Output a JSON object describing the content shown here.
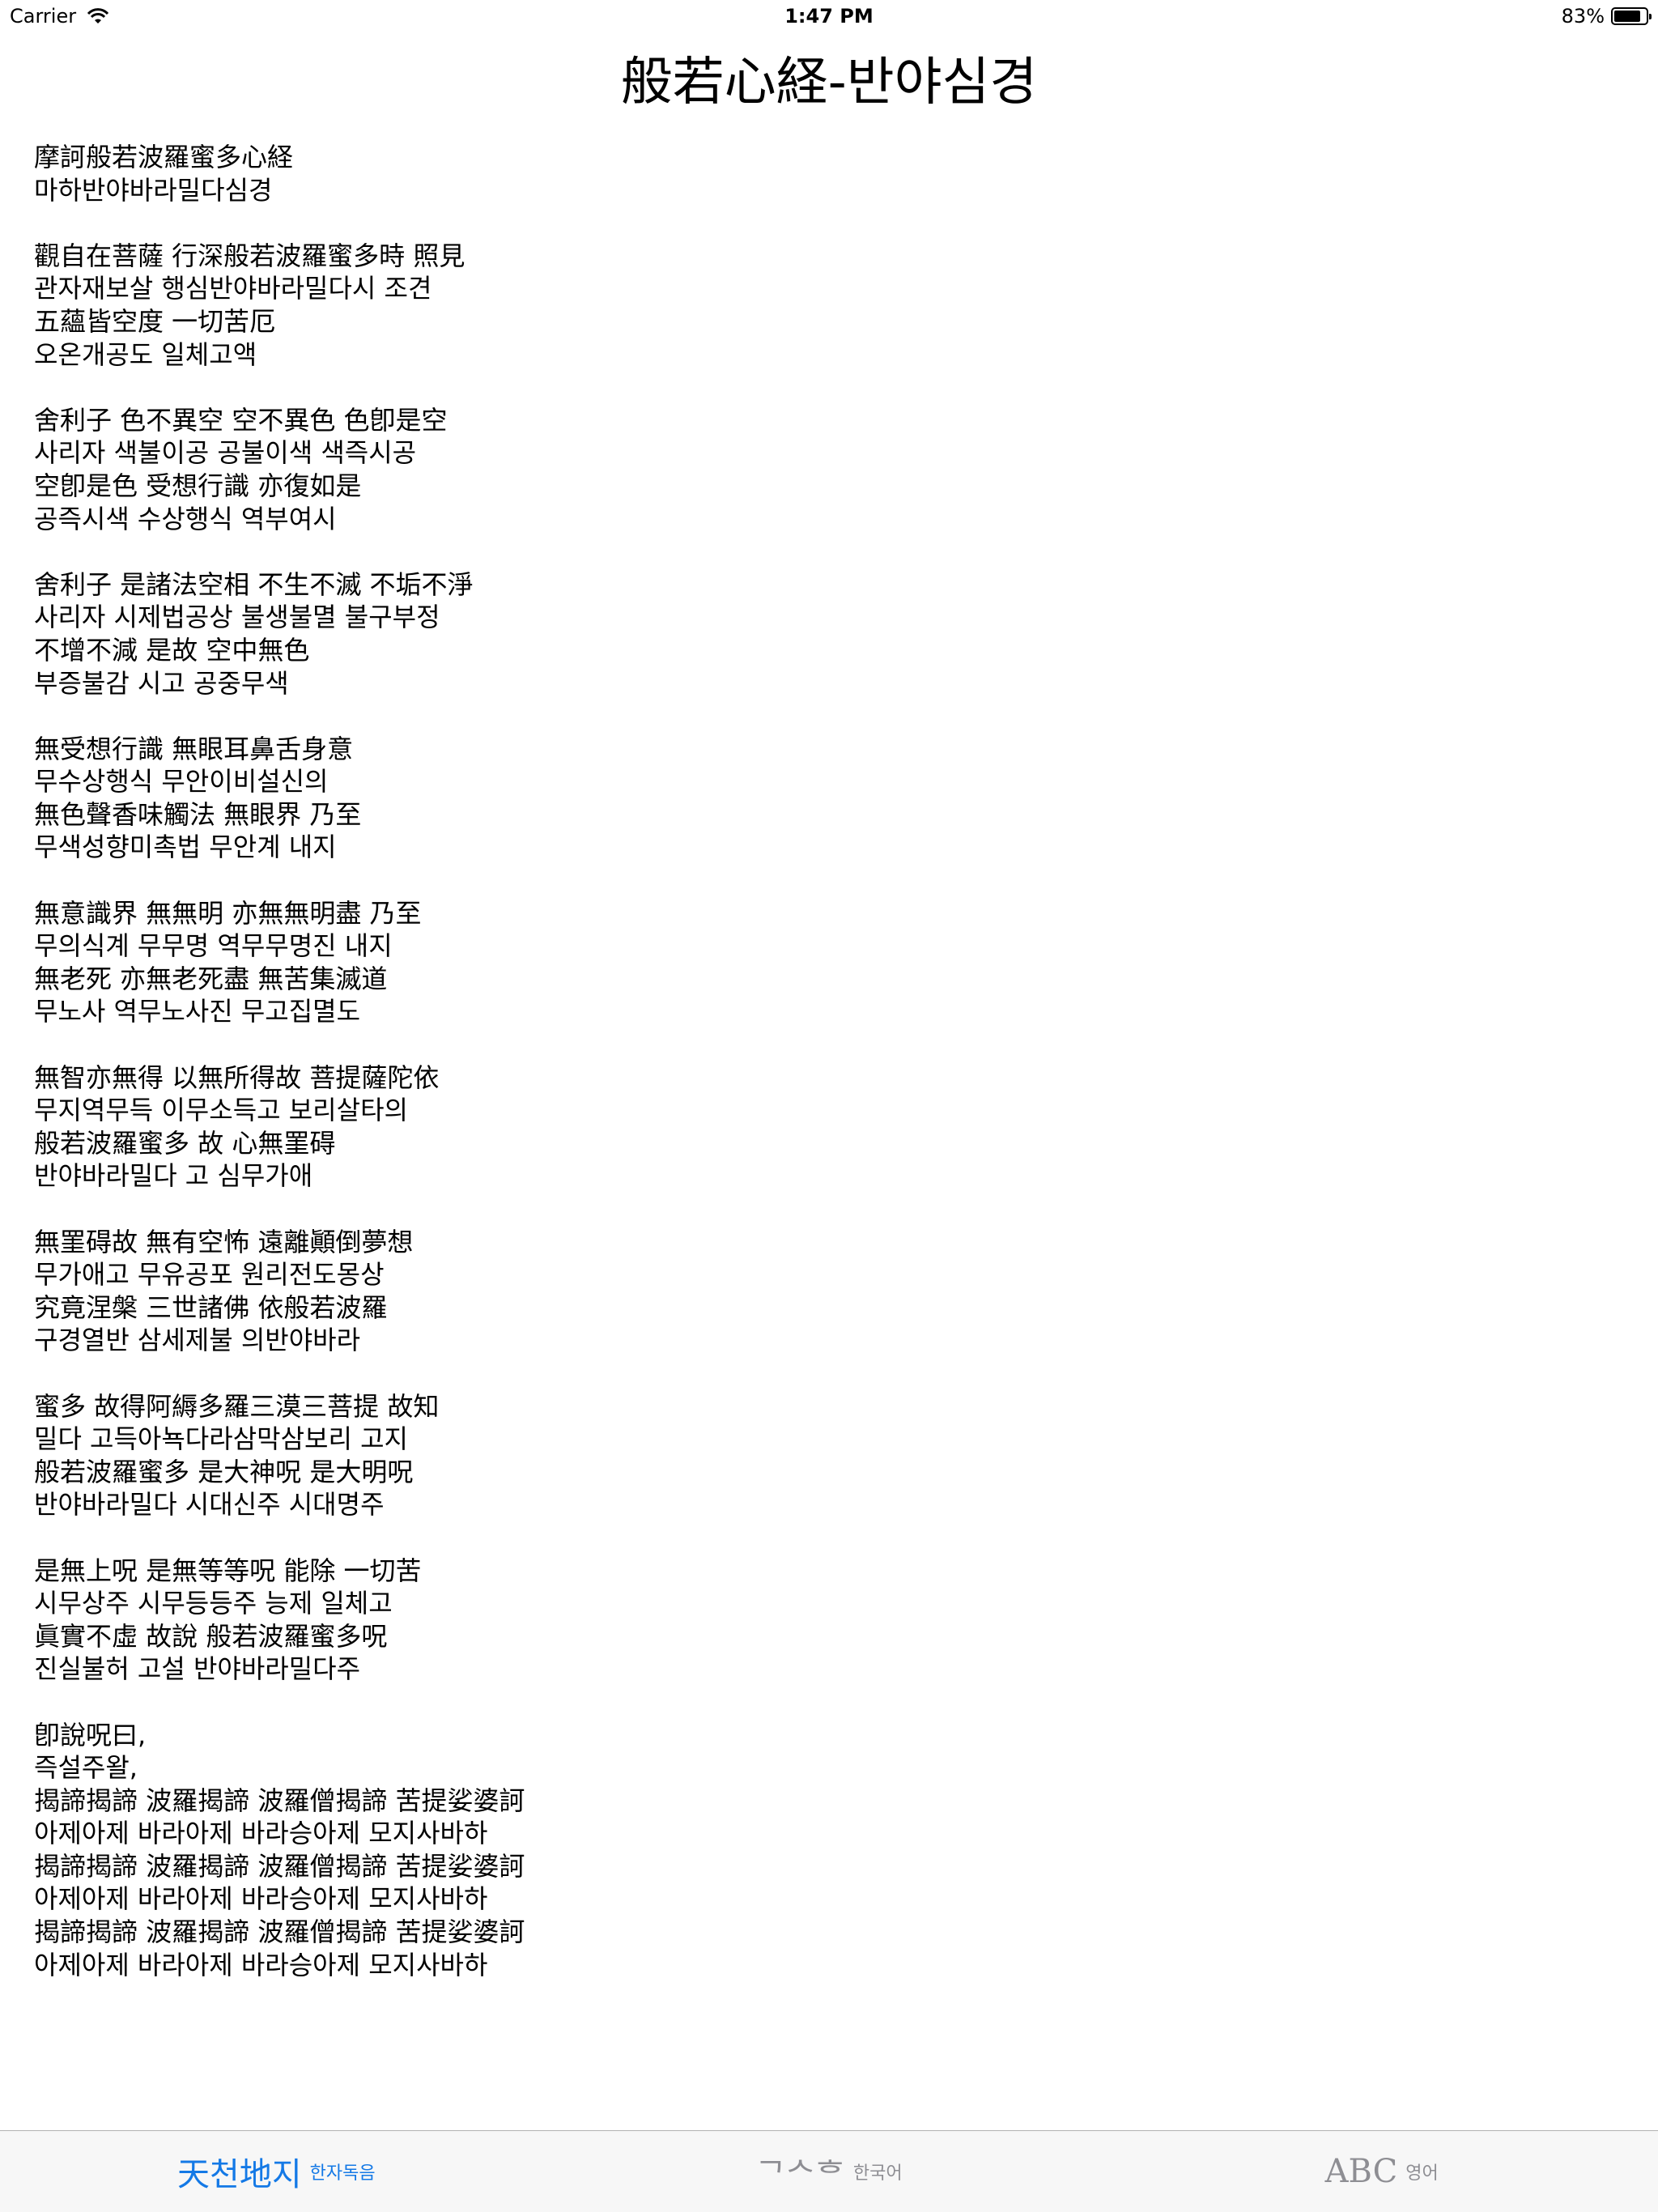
{
  "status_bar": {
    "carrier": "Carrier",
    "time": "1:47 PM",
    "battery": "83%",
    "battery_level": 0.83
  },
  "title": "般若心経-반야심경",
  "stanzas": [
    [
      "摩訶般若波羅蜜多心経",
      "마하반야바라밀다심경"
    ],
    [
      "觀自在菩薩 行深般若波羅蜜多時 照見",
      "관자재보살 행심반야바라밀다시 조견",
      "五蘊皆空度 一切苦厄",
      "오온개공도 일체고액"
    ],
    [
      "舍利子 色不異空 空不異色 色卽是空",
      "사리자 색불이공 공불이색 색즉시공",
      "空卽是色 受想行識 亦復如是",
      "공즉시색 수상행식 역부여시"
    ],
    [
      "舍利子 是諸法空相 不生不滅 不垢不淨",
      "사리자 시제법공상 불생불멸 불구부정",
      "不增不減 是故 空中無色",
      "부증불감 시고 공중무색"
    ],
    [
      "無受想行識 無眼耳鼻舌身意",
      "무수상행식 무안이비설신의",
      "無色聲香味觸法 無眼界 乃至",
      "무색성향미촉법 무안계 내지"
    ],
    [
      "無意識界 無無明 亦無無明盡 乃至",
      "무의식계 무무명 역무무명진 내지",
      "無老死 亦無老死盡 無苦集滅道",
      "무노사 역무노사진 무고집멸도"
    ],
    [
      "無智亦無得 以無所得故 菩提薩陀依",
      "무지역무득 이무소득고 보리살타의",
      "般若波羅蜜多 故 心無罣碍",
      "반야바라밀다 고 심무가애"
    ],
    [
      "無罣碍故 無有空怖 遠離顚倒夢想",
      "무가애고 무유공포 원리전도몽상",
      "究竟涅槃 三世諸佛 依般若波羅",
      "구경열반 삼세제불 의반야바라"
    ],
    [
      "蜜多 故得阿縟多羅三漠三菩提 故知",
      "밀다 고득아뇩다라삼막삼보리 고지",
      "般若波羅蜜多 是大神呪 是大明呪",
      "반야바라밀다 시대신주 시대명주"
    ],
    [
      "是無上呪 是無等等呪 能除 一切苦",
      "시무상주 시무등등주 능제 일체고",
      "眞實不虛 故說 般若波羅蜜多呪",
      "진실불허 고설 반야바라밀다주"
    ],
    [
      "卽說呪曰,",
      "즉설주왈,",
      "揭諦揭諦 波羅揭諦 波羅僧揭諦 苦提娑婆訶",
      "아제아제 바라아제 바라승아제 모지사바하",
      "揭諦揭諦 波羅揭諦 波羅僧揭諦 苦提娑婆訶",
      "아제아제 바라아제 바라승아제 모지사바하",
      "揭諦揭諦 波羅揭諦 波羅僧揭諦 苦提娑婆訶",
      "아제아제 바라아제 바라승아제 모지사바하"
    ]
  ],
  "tabs": [
    {
      "label": "한자독음",
      "icon": "천지-icon",
      "icon_text": "天천地지",
      "active": true
    },
    {
      "label": "한국어",
      "icon": "hangul-icon",
      "icon_text": "ᄀᄉᄒ",
      "active": false
    },
    {
      "label": "영어",
      "icon": "abc-icon",
      "icon_text": "ABC",
      "active": false
    }
  ],
  "colors": {
    "accent": "#1479e6",
    "inactive": "#8e8e93",
    "tab_bar_bg": "#f7f7f7"
  }
}
